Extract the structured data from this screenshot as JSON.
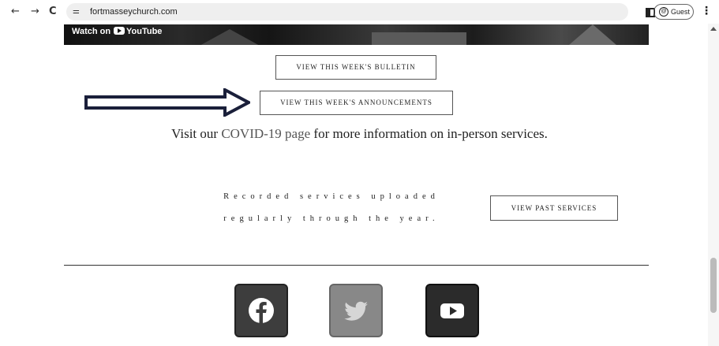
{
  "browser": {
    "url": "fortmasseychurch.com",
    "profile_label": "Guest",
    "back_icon": "←",
    "forward_icon": "→",
    "reload_icon": "C",
    "menu_icon": "⋮"
  },
  "video": {
    "watch_on": "Watch on",
    "youtube": "YouTube"
  },
  "buttons": {
    "bulletin": "VIEW THIS WEEK'S BULLETIN",
    "announcements": "VIEW THIS WEEK'S ANNOUNCEMENTS",
    "past_services": "VIEW PAST SERVICES"
  },
  "covid": {
    "prefix": "Visit our ",
    "link": "COVID-19 page",
    "suffix": " for more information on in-person services."
  },
  "recorded": {
    "line1": "Recorded services uploaded",
    "line2": "regularly through the year."
  },
  "social": {
    "facebook": "facebook-icon",
    "twitter": "twitter-icon",
    "youtube": "youtube-icon"
  }
}
